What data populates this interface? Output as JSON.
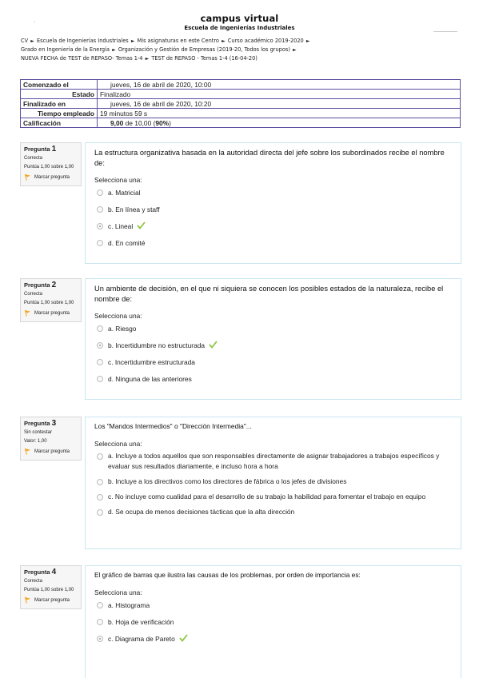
{
  "header": {
    "title": "campus virtual",
    "subtitle": "Escuela de Ingenierías Industriales"
  },
  "breadcrumb": {
    "line1": [
      "CV",
      "Escuela de Ingenierías Industriales",
      "Mis asignaturas en este Centro",
      "Curso académico 2019-2020"
    ],
    "line2": [
      "Grado en Ingeniería de la Energía",
      "Organización y Gestión de Empresas (2019-20, Todos los grupos)"
    ],
    "line3": [
      "NUEVA FECHA de TEST de REPASO- Temas 1-4",
      "TEST de REPASO - Temas 1-4 (16-04-20)"
    ],
    "separator": "►"
  },
  "summary": {
    "started_label": "Comenzado el",
    "started_value": "jueves, 16 de abril de 2020, 10:00",
    "state_label": "Estado",
    "state_value": "Finalizado",
    "finished_label": "Finalizado en",
    "finished_value": "jueves, 16 de abril de 2020, 10:20",
    "time_label": "Tiempo empleado",
    "time_value": "19 minutos 59 s",
    "grade_label": "Calificación",
    "grade_score": "9,00",
    "grade_of": " de 10,00 (",
    "grade_percent": "90%",
    "grade_close": ")"
  },
  "questions": [
    {
      "label": "Pregunta",
      "number": "1",
      "state": "Correcta",
      "grade": "Puntúa 1,00 sobre 1,00",
      "flag": "Marcar pregunta",
      "text": "La estructura organizativa basada en la autoridad directa del jefe sobre los subordinados recibe el nombre de:",
      "prompt": "Selecciona una:",
      "answers": [
        "a. Matricial",
        "b. En línea y staff",
        "c. Lineal",
        "d. En comité"
      ]
    },
    {
      "label": "Pregunta",
      "number": "2",
      "state": "Correcta",
      "grade": "Puntúa 1,00 sobre 1,00",
      "flag": "Marcar pregunta",
      "text": "Un ambiente de decisión, en el que ni siquiera se conocen los posibles estados de la naturaleza, recibe el nombre de:",
      "prompt": "Selecciona una:",
      "answers": [
        "a. Riesgo",
        "b. Incertidumbre no estructurada",
        "c. Incertidumbre estructurada",
        "d. Ninguna de las anteriores"
      ]
    },
    {
      "label": "Pregunta",
      "number": "3",
      "state": "Sin contestar",
      "grade": "Valor: 1,00",
      "flag": "Marcar pregunta",
      "text": "Los \"Mandos Intermedios\" o \"Dirección Intermedia\"...",
      "prompt": "Selecciona una:",
      "answers": [
        "a. Incluye a todos aquellos que son responsables directamente de asignar trabajadores a trabajos específicos y evaluar sus resultados diariamente, e incluso hora a hora",
        "b. Incluye a los directivos como los directores de fábrica o los jefes de divisiones",
        "c. No incluye como cualidad para el desarrollo de su trabajo la habilidad para fomentar el trabajo en equipo",
        "d. Se ocupa de menos decisiones tácticas que la alta dirección"
      ]
    },
    {
      "label": "Pregunta",
      "number": "4",
      "state": "Correcta",
      "grade": "Puntúa 1,00 sobre 1,00",
      "flag": "Marcar pregunta",
      "text": "El gráfico de barras que ilustra las causas de los problemas, por orden de importancia es:",
      "prompt": "Selecciona una:",
      "answers": [
        "a. Histograma",
        "b. Hoja de verificación",
        "c. Diagrama de Pareto"
      ]
    }
  ],
  "colors": {
    "summary_border": "#5b4e9e",
    "content_border": "#c9e6f0",
    "check_green": "#8cc63f",
    "flag_orange": "#f5a623"
  }
}
